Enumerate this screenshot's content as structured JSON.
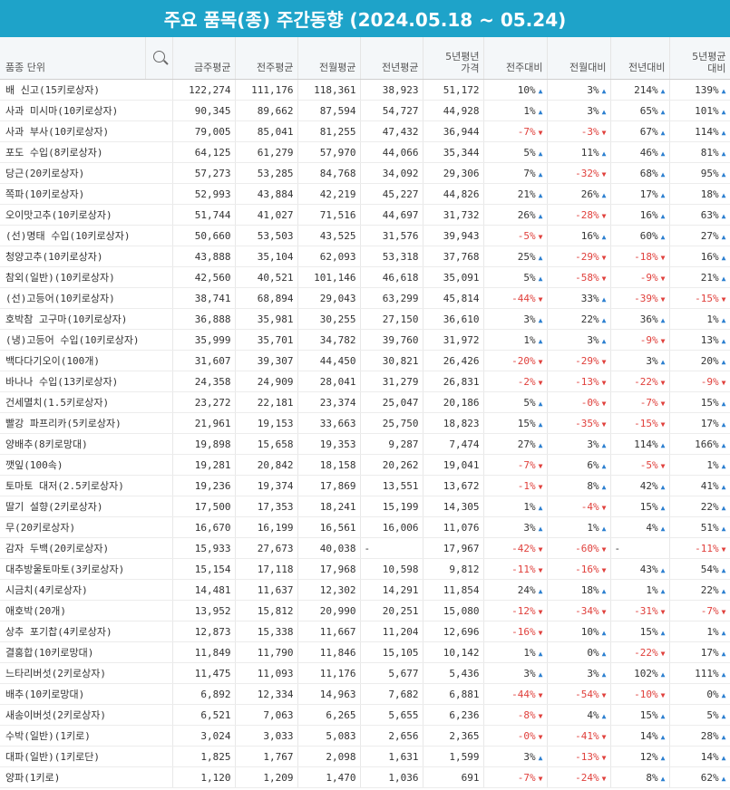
{
  "title": "주요 품목(종) 주간동향 (2024.05.18 ~ 05.24)",
  "header": {
    "name": "품종 단위",
    "cols": [
      "금주평균",
      "전주평균",
      "전월평균",
      "전년평균",
      "5년평년 가격",
      "전주대비",
      "전월대비",
      "전년대비",
      "5년평균 대비"
    ]
  },
  "rows": [
    [
      "배 신고(15키로상자)",
      "122,274",
      "111,176",
      "118,361",
      "38,923",
      "51,172",
      "10%",
      "3%",
      "214%",
      "139%"
    ],
    [
      "사과 미시마(10키로상자)",
      "90,345",
      "89,662",
      "87,594",
      "54,727",
      "44,928",
      "1%",
      "3%",
      "65%",
      "101%"
    ],
    [
      "사과 부사(10키로상자)",
      "79,005",
      "85,041",
      "81,255",
      "47,432",
      "36,944",
      "-7%",
      "-3%",
      "67%",
      "114%"
    ],
    [
      "포도 수입(8키로상자)",
      "64,125",
      "61,279",
      "57,970",
      "44,066",
      "35,344",
      "5%",
      "11%",
      "46%",
      "81%"
    ],
    [
      "당근(20키로상자)",
      "57,273",
      "53,285",
      "84,768",
      "34,092",
      "29,306",
      "7%",
      "-32%",
      "68%",
      "95%"
    ],
    [
      "쪽파(10키로상자)",
      "52,993",
      "43,884",
      "42,219",
      "45,227",
      "44,826",
      "21%",
      "26%",
      "17%",
      "18%"
    ],
    [
      "오이맛고추(10키로상자)",
      "51,744",
      "41,027",
      "71,516",
      "44,697",
      "31,732",
      "26%",
      "-28%",
      "16%",
      "63%"
    ],
    [
      "(선)명태 수입(10키로상자)",
      "50,660",
      "53,503",
      "43,525",
      "31,576",
      "39,943",
      "-5%",
      "16%",
      "60%",
      "27%"
    ],
    [
      "청양고추(10키로상자)",
      "43,888",
      "35,104",
      "62,093",
      "53,318",
      "37,768",
      "25%",
      "-29%",
      "-18%",
      "16%"
    ],
    [
      "참외(일반)(10키로상자)",
      "42,560",
      "40,521",
      "101,146",
      "46,618",
      "35,091",
      "5%",
      "-58%",
      "-9%",
      "21%"
    ],
    [
      "(선)고등어(10키로상자)",
      "38,741",
      "68,894",
      "29,043",
      "63,299",
      "45,814",
      "-44%",
      "33%",
      "-39%",
      "-15%"
    ],
    [
      "호박참 고구마(10키로상자)",
      "36,888",
      "35,981",
      "30,255",
      "27,150",
      "36,610",
      "3%",
      "22%",
      "36%",
      "1%"
    ],
    [
      "(냉)고등어 수입(10키로상자)",
      "35,999",
      "35,701",
      "34,782",
      "39,760",
      "31,972",
      "1%",
      "3%",
      "-9%",
      "13%"
    ],
    [
      "백다다기오이(100개)",
      "31,607",
      "39,307",
      "44,450",
      "30,821",
      "26,426",
      "-20%",
      "-29%",
      "3%",
      "20%"
    ],
    [
      "바나나 수입(13키로상자)",
      "24,358",
      "24,909",
      "28,041",
      "31,279",
      "26,831",
      "-2%",
      "-13%",
      "-22%",
      "-9%"
    ],
    [
      "건세멸치(1.5키로상자)",
      "23,272",
      "22,181",
      "23,374",
      "25,047",
      "20,186",
      "5%",
      "-0%",
      "-7%",
      "15%"
    ],
    [
      "빨강 파프리카(5키로상자)",
      "21,961",
      "19,153",
      "33,663",
      "25,750",
      "18,823",
      "15%",
      "-35%",
      "-15%",
      "17%"
    ],
    [
      "양배추(8키로망대)",
      "19,898",
      "15,658",
      "19,353",
      "9,287",
      "7,474",
      "27%",
      "3%",
      "114%",
      "166%"
    ],
    [
      "깻잎(100속)",
      "19,281",
      "20,842",
      "18,158",
      "20,262",
      "19,041",
      "-7%",
      "6%",
      "-5%",
      "1%"
    ],
    [
      "토마토 대저(2.5키로상자)",
      "19,236",
      "19,374",
      "17,869",
      "13,551",
      "13,672",
      "-1%",
      "8%",
      "42%",
      "41%"
    ],
    [
      "딸기 설향(2키로상자)",
      "17,500",
      "17,353",
      "18,241",
      "15,199",
      "14,305",
      "1%",
      "-4%",
      "15%",
      "22%"
    ],
    [
      "무(20키로상자)",
      "16,670",
      "16,199",
      "16,561",
      "16,006",
      "11,076",
      "3%",
      "1%",
      "4%",
      "51%"
    ],
    [
      "감자 두백(20키로상자)",
      "15,933",
      "27,673",
      "40,038",
      "-",
      "17,967",
      "-42%",
      "-60%",
      "-",
      "-11%"
    ],
    [
      "대추방울토마토(3키로상자)",
      "15,154",
      "17,118",
      "17,968",
      "10,598",
      "9,812",
      "-11%",
      "-16%",
      "43%",
      "54%"
    ],
    [
      "시금치(4키로상자)",
      "14,481",
      "11,637",
      "12,302",
      "14,291",
      "11,854",
      "24%",
      "18%",
      "1%",
      "22%"
    ],
    [
      "애호박(20개)",
      "13,952",
      "15,812",
      "20,990",
      "20,251",
      "15,080",
      "-12%",
      "-34%",
      "-31%",
      "-7%"
    ],
    [
      "상추 포기찹(4키로상자)",
      "12,873",
      "15,338",
      "11,667",
      "11,204",
      "12,696",
      "-16%",
      "10%",
      "15%",
      "1%"
    ],
    [
      "결홍합(10키로망대)",
      "11,849",
      "11,790",
      "11,846",
      "15,105",
      "10,142",
      "1%",
      "0%",
      "-22%",
      "17%"
    ],
    [
      "느타리버섯(2키로상자)",
      "11,475",
      "11,093",
      "11,176",
      "5,677",
      "5,436",
      "3%",
      "3%",
      "102%",
      "111%"
    ],
    [
      "배추(10키로망대)",
      "6,892",
      "12,334",
      "14,963",
      "7,682",
      "6,881",
      "-44%",
      "-54%",
      "-10%",
      "0%"
    ],
    [
      "새송이버섯(2키로상자)",
      "6,521",
      "7,063",
      "6,265",
      "5,655",
      "6,236",
      "-8%",
      "4%",
      "15%",
      "5%"
    ],
    [
      "수박(일반)(1키로)",
      "3,024",
      "3,033",
      "5,083",
      "2,656",
      "2,365",
      "-0%",
      "-41%",
      "14%",
      "28%"
    ],
    [
      "대파(일반)(1키로단)",
      "1,825",
      "1,767",
      "2,098",
      "1,631",
      "1,599",
      "3%",
      "-13%",
      "12%",
      "14%"
    ],
    [
      "양파(1키로)",
      "1,120",
      "1,209",
      "1,470",
      "1,036",
      "691",
      "-7%",
      "-24%",
      "8%",
      "62%"
    ]
  ],
  "colors": {
    "title_bg": "#1ea3c9",
    "up_arrow": "#2b7fd0",
    "down": "#e0403c"
  },
  "icons": {
    "search": "search-icon",
    "up": "▲",
    "down": "▼"
  }
}
